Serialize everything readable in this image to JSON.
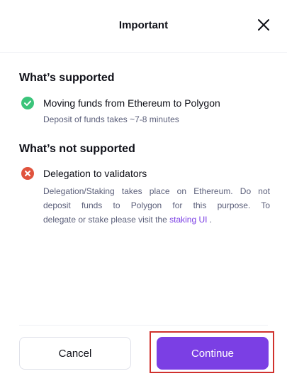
{
  "dialog": {
    "title": "Important",
    "close_icon": "close-icon"
  },
  "supported": {
    "heading": "What’s supported",
    "icon": "check-circle-icon",
    "icon_color": "#3bc47a",
    "item_label": "Moving funds from Ethereum to Polygon",
    "item_desc": "Deposit of funds takes ~7-8 minutes"
  },
  "not_supported": {
    "heading": "What’s not supported",
    "icon": "x-circle-icon",
    "icon_color": "#e0533d",
    "item_label": "Delegation to validators",
    "desc_line1": "Delegation/Staking takes place on Ethereum. Do not",
    "desc_line2": "deposit funds to Polygon for this purpose. To",
    "desc_line3_prefix": "delegate or stake please visit the ",
    "desc_link": "staking UI",
    "desc_line3_suffix": " ."
  },
  "footer": {
    "cancel_label": "Cancel",
    "continue_label": "Continue"
  },
  "colors": {
    "accent": "#7b3fe4",
    "highlight_border": "#d0312d"
  }
}
